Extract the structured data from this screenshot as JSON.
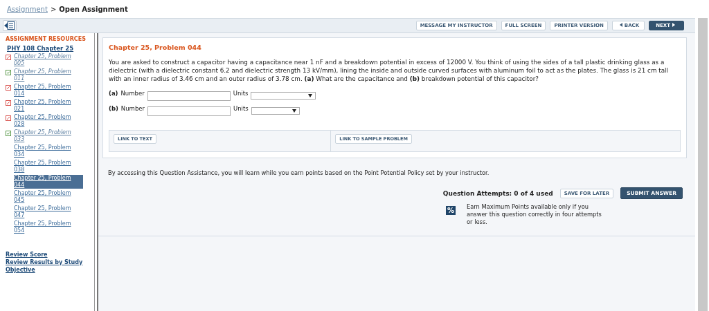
{
  "breadcrumb": {
    "link": "Assignment",
    "separator": ">",
    "current": "Open Assignment"
  },
  "toolbar": {
    "buttons": [
      {
        "label": "MESSAGE MY INSTRUCTOR",
        "kind": "plain"
      },
      {
        "label": "FULL SCREEN",
        "kind": "plain"
      },
      {
        "label": "PRINTER VERSION",
        "kind": "plain"
      },
      {
        "label": "BACK",
        "kind": "back"
      },
      {
        "label": "NEXT",
        "kind": "next"
      }
    ]
  },
  "sidebar": {
    "heading": "ASSIGNMENT RESOURCES",
    "course": "PHY 108 Chapter 25",
    "items": [
      {
        "label": "Chapter 25, Problem 005",
        "kind": "partial",
        "visited": true,
        "selected": false
      },
      {
        "label": "Chapter 25, Problem 011",
        "kind": "correct",
        "visited": true,
        "selected": false
      },
      {
        "label": "Chapter 25, Problem 014",
        "kind": "partial",
        "visited": false,
        "selected": false
      },
      {
        "label": "Chapter 25, Problem 021",
        "kind": "partial",
        "visited": false,
        "selected": false
      },
      {
        "label": "Chapter 25, Problem 028",
        "kind": "partial",
        "visited": false,
        "selected": false
      },
      {
        "label": "Chapter 25, Problem 033",
        "kind": "correct",
        "visited": true,
        "selected": false
      },
      {
        "label": "Chapter 25, Problem 034",
        "kind": "plain",
        "visited": false,
        "selected": false
      },
      {
        "label": "Chapter 25, Problem 038",
        "kind": "plain",
        "visited": false,
        "selected": false
      },
      {
        "label": "Chapter 25, Problem 044",
        "kind": "plain",
        "visited": false,
        "selected": true
      },
      {
        "label": "Chapter 25, Problem 045",
        "kind": "plain",
        "visited": false,
        "selected": false
      },
      {
        "label": "Chapter 25, Problem 047",
        "kind": "plain",
        "visited": false,
        "selected": false
      },
      {
        "label": "Chapter 25, Problem 054",
        "kind": "plain",
        "visited": false,
        "selected": false
      }
    ],
    "links": [
      "Review Score",
      "Review Results by Study Objective"
    ]
  },
  "problem": {
    "title": "Chapter 25, Problem 044",
    "text": "You are asked to construct a capacitor having a capacitance near 1 nF and a breakdown potential in excess of 12000 V. You think of using the sides of a tall plastic drinking glass as a dielectric (with a dielectric constant 6.2 and dielectric strength 13 kV/mm), lining the inside and outside curved surfaces with aluminum foil to act as the plates. The glass is 21 cm tall with an inner radius of 3.46 cm and an outer radius of 3.78 cm. **(a)** What are the capacitance and **(b)** breakdown potential of this capacitor?",
    "answers": [
      {
        "part": "(a)",
        "label": "Number",
        "units_label": "Units"
      },
      {
        "part": "(b)",
        "label": "Number",
        "units_label": "Units"
      }
    ],
    "links": [
      "LINK TO TEXT",
      "LINK TO SAMPLE PROBLEM"
    ]
  },
  "assistance": {
    "notice": "By accessing this Question Assistance, you will learn while you earn points based on the Point Potential Policy set by your instructor.",
    "attempts": "Question Attempts: 0 of 4 used",
    "save": "SAVE FOR LATER",
    "submit": "SUBMIT ANSWER",
    "badge": "%",
    "policy": "Earn Maximum Points available only if you answer this question correctly in four attempts or less."
  }
}
